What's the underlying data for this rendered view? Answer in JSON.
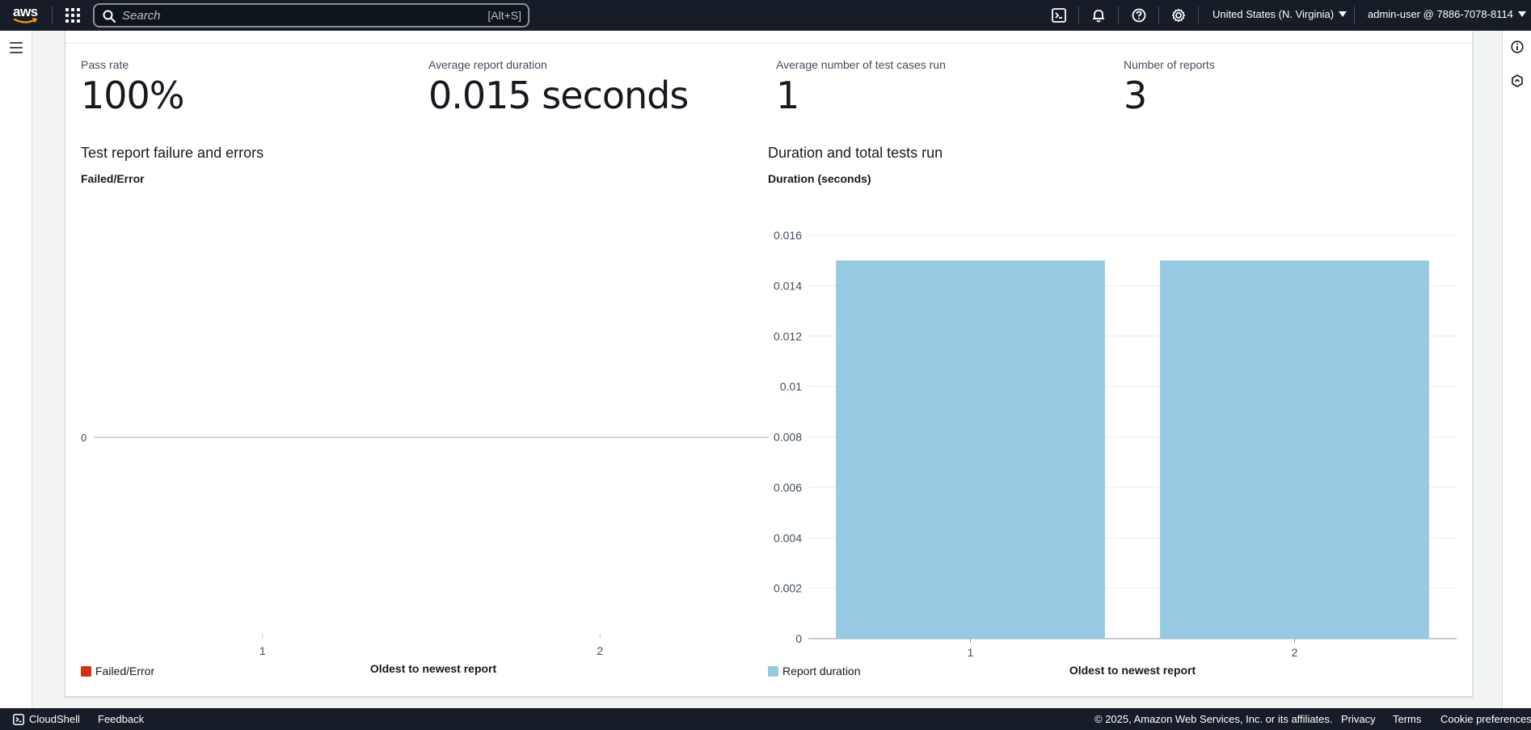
{
  "topnav": {
    "logo_text": "aws",
    "search": {
      "placeholder": "Search",
      "shortcut": "[Alt+S]"
    },
    "region": "United States (N. Virginia)",
    "account": "admin-user @ 7886-7078-8114",
    "icons": [
      "cloudshell-icon",
      "bell-icon",
      "help-icon",
      "gear-icon"
    ]
  },
  "metrics": [
    {
      "label": "Pass rate",
      "value": "100%"
    },
    {
      "label": "Average report duration",
      "value": "0.015 seconds"
    },
    {
      "label": "Average number of test cases run",
      "value": "1"
    },
    {
      "label": "Number of reports",
      "value": "3"
    }
  ],
  "colors": {
    "failed": "#d13212",
    "duration": "#98c9e3",
    "nav": "#161d26"
  },
  "chart_data": [
    {
      "type": "bar",
      "title": "Test report failure and errors",
      "ylabel": "Failed/Error",
      "xlabel": "Oldest to newest report",
      "categories": [
        "1",
        "2"
      ],
      "series": [
        {
          "name": "Failed/Error",
          "values": [
            0,
            0
          ]
        }
      ],
      "y_ticks": [
        "0"
      ],
      "legend": "bottom-left",
      "grid": false
    },
    {
      "type": "bar",
      "title": "Duration and total tests run",
      "ylabel": "Duration (seconds)",
      "xlabel": "Oldest to newest report",
      "categories": [
        "1",
        "2"
      ],
      "series": [
        {
          "name": "Report duration",
          "values": [
            0.015,
            0.015
          ]
        }
      ],
      "ylim": [
        0,
        0.016
      ],
      "y_ticks": [
        "0",
        "0.002",
        "0.004",
        "0.006",
        "0.008",
        "0.01",
        "0.012",
        "0.014",
        "0.016"
      ],
      "legend": "bottom-left",
      "grid": true
    }
  ],
  "footer": {
    "cloudshell": "CloudShell",
    "feedback": "Feedback",
    "copyright": "© 2025, Amazon Web Services, Inc. or its affiliates.",
    "privacy": "Privacy",
    "terms": "Terms",
    "cookies": "Cookie preferences"
  }
}
